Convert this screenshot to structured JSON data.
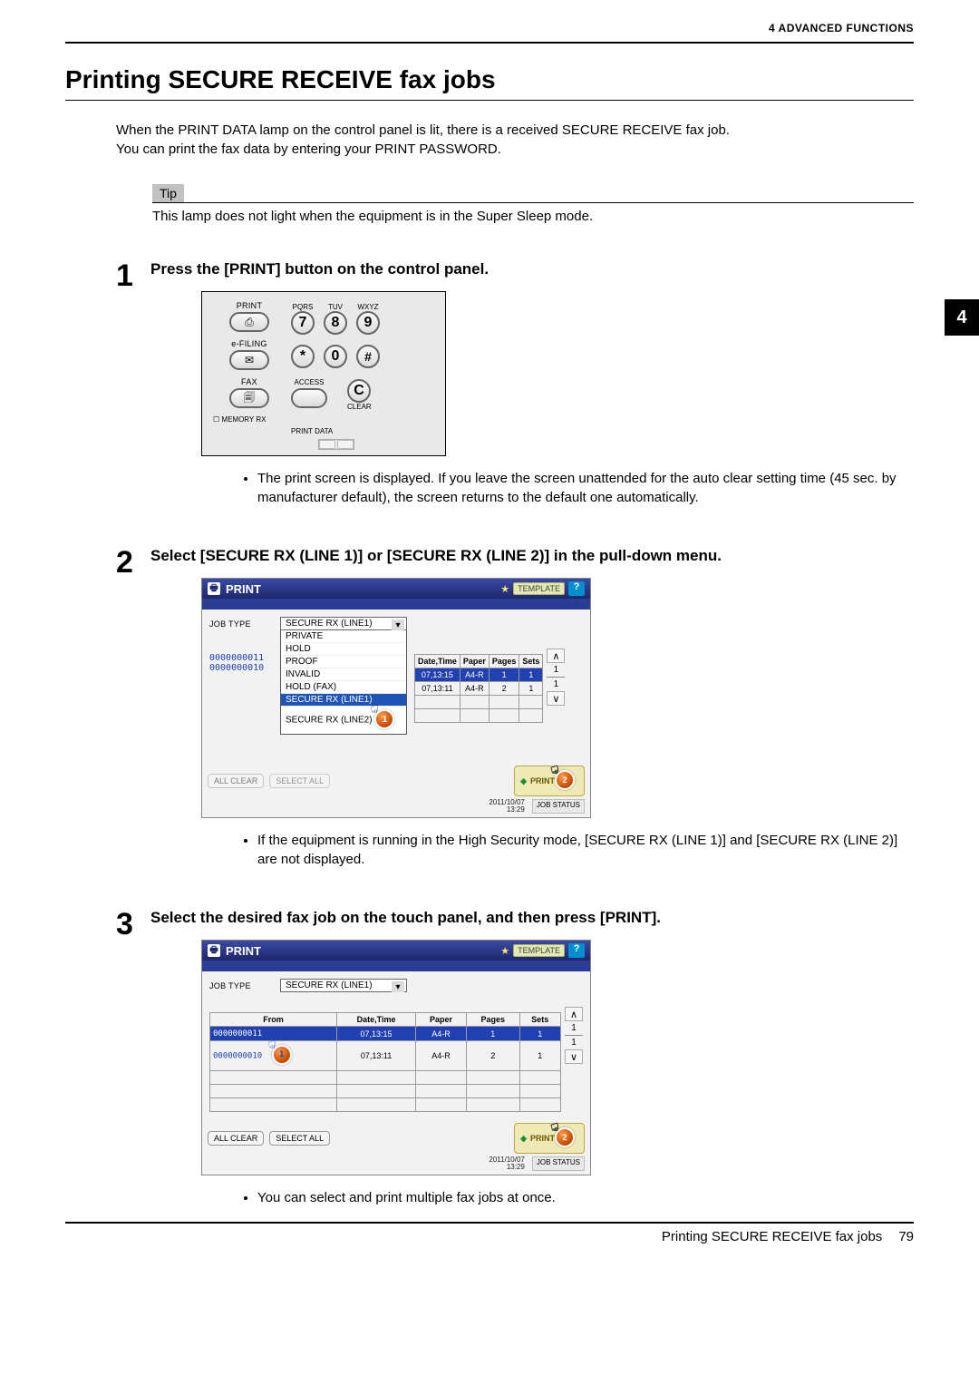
{
  "header": {
    "breadcrumb": "4 ADVANCED FUNCTIONS"
  },
  "chapter_tab": "4",
  "title": "Printing SECURE RECEIVE fax jobs",
  "intro": [
    "When the PRINT DATA  lamp on the control panel is lit, there is a received SECURE RECEIVE fax job.",
    "You can print the fax data by entering your PRINT PASSWORD."
  ],
  "tip": {
    "label": "Tip",
    "text": "This lamp does not light when the equipment is in the Super Sleep mode."
  },
  "steps": {
    "s1": {
      "num": "1",
      "title": "Press the [PRINT] button on the control panel.",
      "bullets": [
        "The print screen is displayed. If you leave the screen unattended for the auto clear setting time (45 sec. by manufacturer default), the screen returns to the default one automatically."
      ]
    },
    "s2": {
      "num": "2",
      "title": "Select [SECURE RX (LINE 1)] or [SECURE RX (LINE 2)] in the pull-down menu.",
      "bullets": [
        "If the equipment is running in the High Security mode, [SECURE RX (LINE 1)] and [SECURE RX (LINE 2)] are not displayed."
      ]
    },
    "s3": {
      "num": "3",
      "title": "Select the desired fax job on the touch panel, and then press [PRINT].",
      "bullets": [
        "You can select and print multiple fax jobs at once."
      ]
    }
  },
  "control_panel": {
    "cols": {
      "print": "PRINT",
      "efiling": "e-FILING",
      "fax": "FAX",
      "memoryrx": "MEMORY RX",
      "printdata": "PRINT DATA"
    },
    "numlabels": {
      "pqrs": "PQRS",
      "tuv": "TUV",
      "wxyz": "WXYZ"
    },
    "keys": {
      "k7": "7",
      "k8": "8",
      "k9": "9",
      "k0": "0",
      "star": "*",
      "hash": "#",
      "c": "C"
    },
    "access": "ACCESS",
    "clear": "CLEAR",
    "print_icon": "⎙",
    "efiling_icon": "✉",
    "fax_icon": "🗐"
  },
  "screens": {
    "common": {
      "title": "PRINT",
      "template": "TEMPLATE",
      "help": "?",
      "job_type_label": "JOB TYPE",
      "col": {
        "from": "From",
        "date": "Date,Time",
        "paper": "Paper",
        "pages": "Pages",
        "sets": "Sets"
      },
      "print_btn": "PRINT",
      "all_clear": "ALL CLEAR",
      "select_all": "SELECT ALL",
      "job_status": "JOB STATUS",
      "timestamp": {
        "date": "2011/10/07",
        "time": "13:29"
      },
      "page": {
        "cur": "1",
        "total": "1"
      }
    },
    "dropdown": {
      "selected": "SECURE RX (LINE1)",
      "options": [
        "PRIVATE",
        "HOLD",
        "PROOF",
        "INVALID",
        "HOLD (FAX)",
        "SECURE RX (LINE1)",
        "SECURE RX (LINE2)"
      ]
    },
    "rows": [
      {
        "num": "0000000011",
        "date": "07,13:15",
        "paper": "A4-R",
        "pages": "1",
        "sets": "1"
      },
      {
        "num": "0000000010",
        "date": "07,13:11",
        "paper": "A4-R",
        "pages": "2",
        "sets": "1"
      }
    ]
  },
  "pointer": {
    "n1": "1",
    "n2": "2"
  },
  "footer": {
    "title": "Printing SECURE RECEIVE fax jobs",
    "page": "79"
  }
}
